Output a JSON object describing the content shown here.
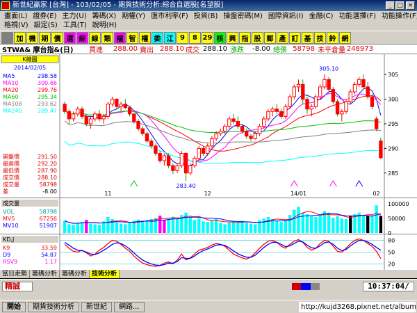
{
  "window": {
    "title": "新世紀贏家 [台灣] - 103/02/05 - 期貨技術分析:綜合自選股[名望股]"
  },
  "menu": {
    "row1": [
      "畫面(L)",
      "證券(E)",
      "主力(U)",
      "籌碼(X)",
      "期權(Y)",
      "匯市利率(F)",
      "投資(B)",
      "操盤密碼(M)",
      "國際資訊(I)",
      "金融(C)",
      "功能選擇(F)",
      "功能操作(F)"
    ],
    "row2": [
      "格視(V)",
      "設定(S)",
      "工具(T)",
      "說明(H)"
    ]
  },
  "toolbar": {
    "buttons": [
      {
        "label": "",
        "bg": "#808080"
      },
      {
        "label": "加",
        "bg": "#ffff00"
      },
      {
        "label": "機",
        "bg": "#ffff00"
      },
      {
        "label": "期",
        "bg": "#ffff00"
      },
      {
        "label": "價",
        "bg": "#ffff00"
      },
      {
        "label": "選",
        "bg": "#ff00ff"
      },
      {
        "label": "綜",
        "bg": "#ff00ff"
      },
      {
        "label": "線",
        "bg": "#ffff00"
      },
      {
        "label": "類",
        "bg": "#ffff00"
      },
      {
        "label": "檔",
        "bg": "#ff00ff"
      },
      {
        "label": "智",
        "bg": "#ffff00"
      },
      {
        "label": "權",
        "bg": "#ffff00"
      },
      {
        "label": "委",
        "bg": "#00ffff"
      },
      {
        "label": "江",
        "bg": "#00ffff"
      },
      {
        "label": "9",
        "bg": "#ffff00"
      },
      {
        "label": "8",
        "bg": "#ffff00"
      },
      {
        "label": "29",
        "bg": "#ffff00"
      },
      {
        "label": "核",
        "bg": "#00ff00"
      },
      {
        "label": "興",
        "bg": "#ffff00"
      },
      {
        "label": "指",
        "bg": "#ffff00"
      },
      {
        "label": "股",
        "bg": "#ffff00"
      },
      {
        "label": "郵",
        "bg": "#ffff00"
      },
      {
        "label": "產",
        "bg": "#ffff00"
      },
      {
        "label": "訂",
        "bg": "#ffff00"
      },
      {
        "label": "基",
        "bg": "#ffff00"
      },
      {
        "label": "技",
        "bg": "#ffff00"
      },
      {
        "label": "鈴",
        "bg": "#ffff00"
      },
      {
        "label": "網",
        "bg": "#ffff00"
      }
    ]
  },
  "quote": {
    "symbol": "STWA& 摩台指&(日)",
    "buy_label": "買進",
    "buy": "288.00",
    "sell_label": "賣出",
    "sell": "288.10",
    "deal_label": "成交",
    "deal": "288.10",
    "change_label": "漲跌",
    "change": "-8.00",
    "volume_label": "總張",
    "volume": "58798",
    "oi_label": "未平倉量",
    "oi": "248973"
  },
  "chart_data": [
    {
      "type": "candlestick",
      "title": "K線圖",
      "date": "2014/02/05",
      "ylim": [
        282,
        308
      ],
      "yticks": [
        285,
        290,
        295,
        300,
        305
      ],
      "xticks": [
        {
          "i": 10,
          "label": "11"
        },
        {
          "i": 33,
          "label": "12"
        },
        {
          "i": 54,
          "label": "14/01"
        },
        {
          "i": 72,
          "label": "02"
        }
      ],
      "annotations": [
        {
          "i": 61,
          "value": 305.1,
          "label": "305.10",
          "pos": "top"
        },
        {
          "i": 28,
          "value": 283.4,
          "label": "283.40",
          "pos": "bottom"
        }
      ],
      "ma": [
        {
          "name": "MA5",
          "value": "298.58",
          "color": "#0000ff",
          "period": 5
        },
        {
          "name": "MA10",
          "value": "300.66",
          "color": "#ff00ff",
          "period": 10
        },
        {
          "name": "MA20",
          "value": "299.76",
          "color": "#ff0000",
          "period": 20
        },
        {
          "name": "MA60",
          "value": "295.34",
          "color": "#00c000",
          "period": 60
        },
        {
          "name": "MA108",
          "value": "293.62",
          "color": "#808080",
          "period": 108
        },
        {
          "name": "MA240",
          "value": "289.47",
          "color": "#00ffff",
          "period": 240
        }
      ],
      "info": [
        {
          "label": "開盤價",
          "value": "291.50"
        },
        {
          "label": "最高價",
          "value": "292.20"
        },
        {
          "label": "最低價",
          "value": "287.90"
        },
        {
          "label": "成交價",
          "value": "288.10"
        },
        {
          "label": "成交量",
          "value": "58798"
        },
        {
          "label": "差",
          "value": "-8.00"
        }
      ],
      "ohlc": [
        [
          299,
          299.5,
          297,
          297.5
        ],
        [
          297.5,
          298,
          295,
          296
        ],
        [
          296,
          297.5,
          295.5,
          297
        ],
        [
          297,
          298.5,
          296.5,
          298
        ],
        [
          298,
          298.5,
          296,
          296.5
        ],
        [
          296.5,
          297,
          294.5,
          295
        ],
        [
          295,
          296.5,
          294,
          296
        ],
        [
          296,
          297.5,
          295.5,
          297
        ],
        [
          297,
          297.8,
          295.5,
          296
        ],
        [
          296,
          297,
          295,
          296.5
        ],
        [
          296.5,
          299.5,
          296,
          299
        ],
        [
          299,
          300.5,
          298.5,
          300
        ],
        [
          300,
          300.2,
          298,
          298.5
        ],
        [
          298.5,
          299.5,
          297.5,
          299
        ],
        [
          299,
          300,
          298,
          298.3
        ],
        [
          298.3,
          298.5,
          296.5,
          297
        ],
        [
          297,
          297.2,
          295,
          295.5
        ],
        [
          295.5,
          296,
          293.5,
          294
        ],
        [
          294,
          294.5,
          292.5,
          293
        ],
        [
          293,
          293.5,
          291,
          291.5
        ],
        [
          291.5,
          292,
          290,
          290.5
        ],
        [
          290.5,
          291,
          288.5,
          289
        ],
        [
          289,
          289.5,
          287,
          287.5
        ],
        [
          287.5,
          289,
          286.5,
          288.5
        ],
        [
          288.5,
          289,
          286,
          286.5
        ],
        [
          286.5,
          287,
          284.8,
          285.5
        ],
        [
          285.5,
          287,
          285,
          286.5
        ],
        [
          286.5,
          289.5,
          286,
          289
        ],
        [
          289,
          289.2,
          283.4,
          285
        ],
        [
          285,
          287,
          284.5,
          286.5
        ],
        [
          286.5,
          288.5,
          286,
          288
        ],
        [
          288,
          290.5,
          287.5,
          290
        ],
        [
          290,
          290.5,
          288.5,
          289
        ],
        [
          289,
          291,
          288.5,
          290.5
        ],
        [
          290.5,
          292.5,
          290,
          292
        ],
        [
          292,
          293.5,
          291.5,
          293
        ],
        [
          293,
          294,
          292.5,
          293.5
        ],
        [
          293.5,
          295,
          293,
          294.5
        ],
        [
          294.5,
          296.5,
          294,
          296
        ],
        [
          296,
          297,
          295,
          295.5
        ],
        [
          295.5,
          296.5,
          294,
          294.5
        ],
        [
          294.5,
          295,
          293,
          293.5
        ],
        [
          293.5,
          294,
          292,
          292.5
        ],
        [
          292.5,
          293,
          291.5,
          292
        ],
        [
          292,
          293.5,
          291.8,
          293
        ],
        [
          293,
          295,
          292.5,
          294.5
        ],
        [
          294.5,
          296.5,
          294,
          296
        ],
        [
          296,
          298,
          295.5,
          297.5
        ],
        [
          297.5,
          298.5,
          296.5,
          298
        ],
        [
          298,
          299,
          297,
          297.5
        ],
        [
          297.5,
          298,
          296,
          296.5
        ],
        [
          296.5,
          299,
          296,
          298.5
        ],
        [
          298.5,
          301,
          298,
          300.5
        ],
        [
          300.5,
          303,
          300,
          302.5
        ],
        [
          302.5,
          304,
          301.5,
          303
        ],
        [
          303,
          304,
          299,
          300
        ],
        [
          300,
          300.5,
          297,
          298
        ],
        [
          298,
          299,
          296.5,
          298.5
        ],
        [
          298.5,
          301,
          298,
          300.5
        ],
        [
          300.5,
          303,
          300,
          302.5
        ],
        [
          302.5,
          305.1,
          302,
          304
        ],
        [
          304,
          304.5,
          301.5,
          302
        ],
        [
          302,
          302.5,
          299,
          299.5
        ],
        [
          299.5,
          300,
          296.5,
          297
        ],
        [
          297,
          298,
          295.5,
          297.5
        ],
        [
          297.5,
          300,
          297,
          299.5
        ],
        [
          299.5,
          302,
          299,
          301.5
        ],
        [
          301.5,
          303.5,
          301,
          303
        ],
        [
          303,
          304.5,
          302.5,
          304
        ],
        [
          304,
          305,
          302,
          302.5
        ],
        [
          302.5,
          303.5,
          300,
          300.5
        ],
        [
          300.5,
          301,
          298,
          298.5
        ],
        [
          296,
          296.5,
          293.5,
          294
        ],
        [
          291.5,
          292.2,
          287.9,
          288.1
        ]
      ]
    },
    {
      "type": "bar",
      "title": "成交量",
      "ylim": [
        0,
        110000
      ],
      "yticks": [
        {
          "v": 0,
          "label": "0"
        },
        {
          "v": 50000,
          "label": "50000"
        },
        {
          "v": 100000,
          "label": "100000"
        }
      ],
      "series": [
        {
          "name": "VOL",
          "value": "58798",
          "color": "#00ffff"
        },
        {
          "name": "MV5",
          "value": "67256",
          "color": "#ff0000"
        },
        {
          "name": "MV10",
          "value": "51907",
          "color": "#0000ff"
        }
      ],
      "values": [
        42000,
        30000,
        28000,
        35000,
        38000,
        45000,
        32000,
        30000,
        28000,
        40000,
        55000,
        48000,
        36000,
        32000,
        30000,
        38000,
        42000,
        46000,
        40000,
        44000,
        48000,
        52000,
        60000,
        45000,
        50000,
        56000,
        48000,
        62000,
        70000,
        55000,
        45000,
        50000,
        40000,
        38000,
        42000,
        48000,
        35000,
        30000,
        36000,
        40000,
        38000,
        42000,
        35000,
        32000,
        30000,
        45000,
        50000,
        55000,
        48000,
        42000,
        38000,
        45000,
        62000,
        80000,
        90000,
        70000,
        65000,
        58000,
        55000,
        62000,
        75000,
        68000,
        52000,
        58000,
        50000,
        48000,
        60000,
        65000,
        70000,
        62000,
        58000,
        60000,
        95000,
        58798
      ],
      "colors": [
        "#00ffff",
        "#00ffff",
        "#00ffff",
        "#00ffff",
        "#00ffff",
        "#ff00ff",
        "#00ffff",
        "#00ffff",
        "#00ffff",
        "#00ffff",
        "#00ffff",
        "#00ffff",
        "#00ffff",
        "#00ffff",
        "#00ffff",
        "#00ffff",
        "#00ffff",
        "#00ffff",
        "#00ffff",
        "#00ffff",
        "#00ffff",
        "#00ffff",
        "#ff00ff",
        "#ff00ff",
        "#00ffff",
        "#00ffff",
        "#00ffff",
        "#00ffff",
        "#00ffff",
        "#00ffff",
        "#00ffff",
        "#00ffff",
        "#00ffff",
        "#00ffff",
        "#00ffff",
        "#00ffff",
        "#00ffff",
        "#00ffff",
        "#00ffff",
        "#00ffff",
        "#00ffff",
        "#00ffff",
        "#00ffff",
        "#00ffff",
        "#00ffff",
        "#00ffff",
        "#00ffff",
        "#00ffff",
        "#00ffff",
        "#00ffff",
        "#00ffff",
        "#00ffff",
        "#00ffff",
        "#00ffff",
        "#00ffff",
        "#00ffff",
        "#00ffff",
        "#00ffff",
        "#00ffff",
        "#00ffff",
        "#00ffff",
        "#00ffff",
        "#00ffff",
        "#00ffff",
        "#00ffff",
        "#00ffff",
        "#000000",
        "#00ffff",
        "#00ffff",
        "#00ffff",
        "#000000",
        "#00ffff",
        "#00ffff",
        "#000000"
      ]
    },
    {
      "type": "line",
      "title": "KD,J",
      "ylim": [
        10,
        90
      ],
      "yticks": [
        20,
        50,
        80
      ],
      "series": [
        {
          "name": "K9",
          "value": "33.59",
          "color": "#ff0000",
          "values": [
            70,
            60,
            52,
            50,
            55,
            48,
            40,
            45,
            55,
            62,
            72,
            80,
            78,
            70,
            60,
            52,
            40,
            30,
            22,
            18,
            15,
            14,
            16,
            22,
            25,
            20,
            30,
            45,
            30,
            35,
            45,
            55,
            58,
            62,
            68,
            72,
            70,
            65,
            55,
            45,
            40,
            35,
            32,
            38,
            48,
            60,
            70,
            78,
            80,
            75,
            65,
            60,
            70,
            78,
            82,
            75,
            62,
            55,
            60,
            72,
            80,
            78,
            65,
            52,
            50,
            60,
            72,
            80,
            84,
            80,
            72,
            65,
            52,
            33.59
          ]
        },
        {
          "name": "D9",
          "value": "54.87",
          "color": "#0000ff",
          "values": [
            75,
            68,
            60,
            55,
            54,
            50,
            45,
            44,
            48,
            55,
            62,
            70,
            74,
            72,
            66,
            58,
            48,
            38,
            30,
            24,
            20,
            17,
            16,
            18,
            22,
            22,
            26,
            36,
            34,
            34,
            40,
            48,
            54,
            58,
            63,
            68,
            69,
            67,
            61,
            53,
            46,
            41,
            37,
            37,
            42,
            52,
            62,
            70,
            75,
            75,
            70,
            64,
            66,
            72,
            78,
            76,
            68,
            61,
            60,
            66,
            74,
            76,
            70,
            60,
            54,
            57,
            66,
            74,
            80,
            80,
            76,
            70,
            62,
            54.87
          ]
        },
        {
          "name": "RSV9",
          "value": "1.17",
          "color": "#ff00ff",
          "values": []
        }
      ]
    }
  ],
  "bottom_tabs": [
    "當日走勢",
    "籌碼分析",
    "籌碼分析",
    "技術分析"
  ],
  "status": {
    "left": "精誠",
    "time": "10:37:04/"
  },
  "taskbar": {
    "items": [
      "開始",
      "期貨技術分析",
      "新世紀",
      "網路..."
    ],
    "watermark": "http://kujd3268.pixnet.net/album"
  }
}
